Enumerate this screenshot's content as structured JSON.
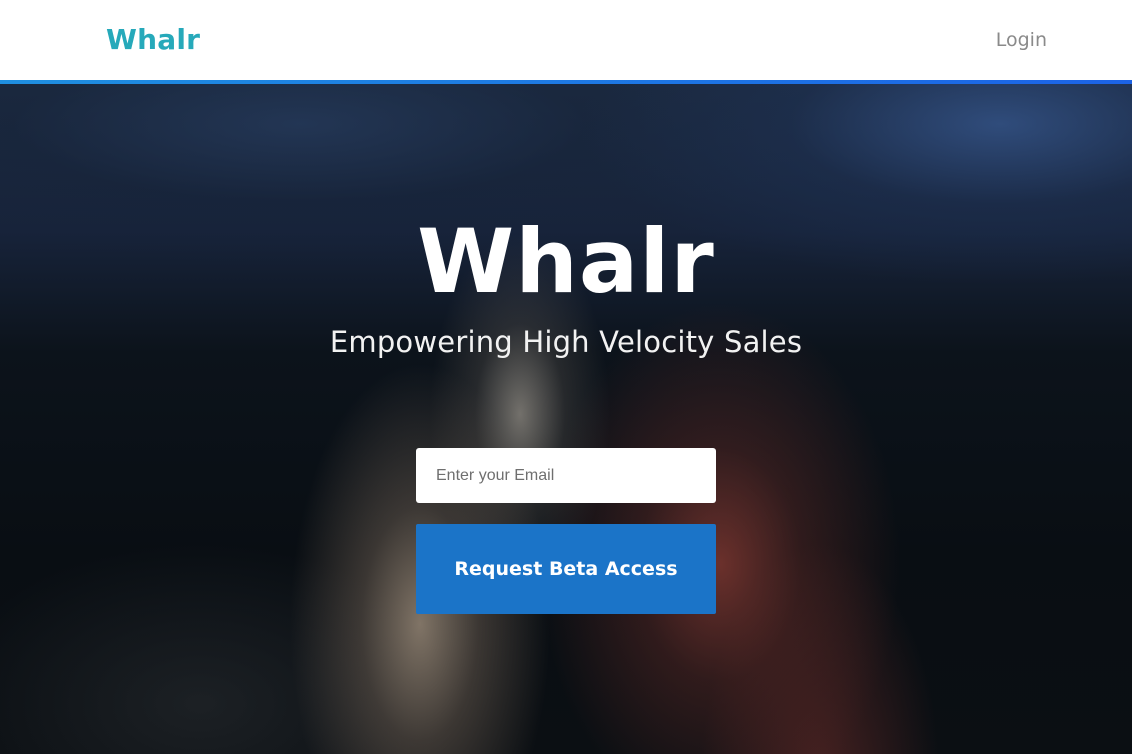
{
  "navbar": {
    "brand": "Whalr",
    "login_label": "Login"
  },
  "hero": {
    "title": "Whalr",
    "subtitle": "Empowering High Velocity Sales",
    "email_placeholder": "Enter your Email",
    "email_value": "",
    "cta_label": "Request Beta Access"
  },
  "colors": {
    "brand": "#26a9ba",
    "accent_bar": "#1c63e6",
    "cta_background": "#1b74c8",
    "login_text": "#8a8a8a"
  }
}
